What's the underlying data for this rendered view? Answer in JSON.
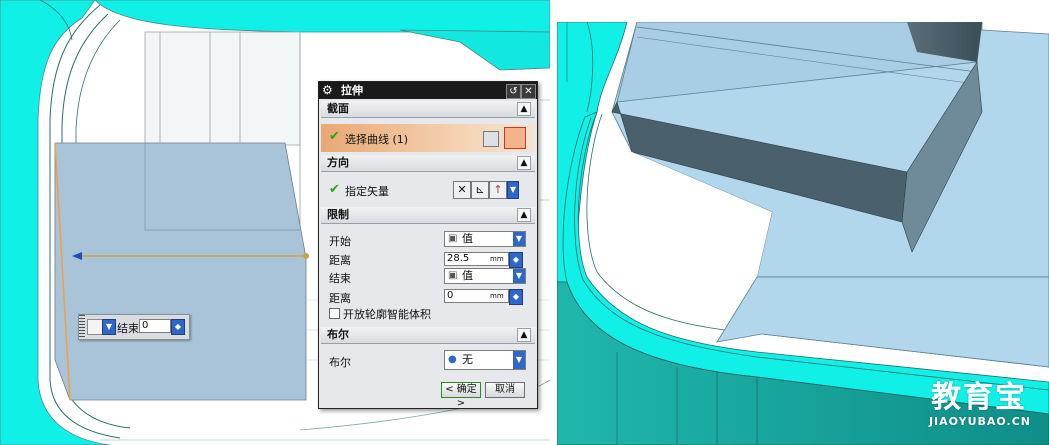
{
  "left_panel": {
    "floating_toolbar": {
      "label": "结束",
      "value": "0"
    }
  },
  "dialog": {
    "title": "拉伸",
    "sections": {
      "section": "截面",
      "direction": "方向",
      "limits": "限制",
      "boolean": "布尔"
    },
    "select_curve": "选择曲线 (1)",
    "specify_vector": "指定矢量",
    "start_label": "开始",
    "start_option": "值",
    "distance_label_1": "距离",
    "distance_value_1": "28.5",
    "unit_1": "mm",
    "end_label": "结束",
    "end_option": "值",
    "distance_label_2": "距离",
    "distance_value_2": "0",
    "unit_2": "mm",
    "open_profile_label": "开放轮廓智能体积",
    "boolean_label": "布尔",
    "boolean_option": "无",
    "ok_label": "< 确定 >",
    "cancel_label": "取消"
  },
  "watermark": {
    "brand": "教育宝",
    "url": "JIAOYUBAO.CN"
  },
  "colors": {
    "cad_surface": "#0ff2e4",
    "sheet_body": "#a9c4d8",
    "selected_row": "#e9a874",
    "direction_line": "#c9a247"
  }
}
